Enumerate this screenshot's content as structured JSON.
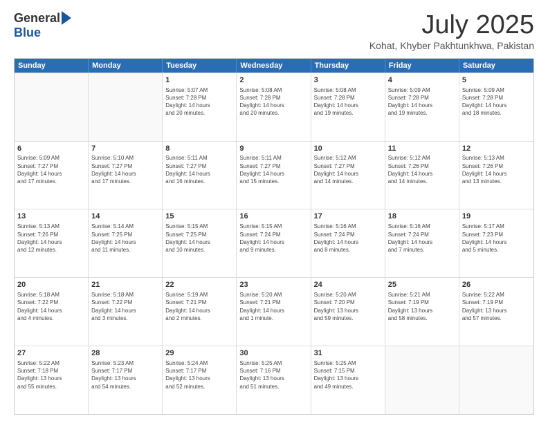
{
  "header": {
    "logo_general": "General",
    "logo_blue": "Blue",
    "month_title": "July 2025",
    "location": "Kohat, Khyber Pakhtunkhwa, Pakistan"
  },
  "weekdays": [
    "Sunday",
    "Monday",
    "Tuesday",
    "Wednesday",
    "Thursday",
    "Friday",
    "Saturday"
  ],
  "weeks": [
    [
      {
        "day": "",
        "info": ""
      },
      {
        "day": "",
        "info": ""
      },
      {
        "day": "1",
        "info": "Sunrise: 5:07 AM\nSunset: 7:28 PM\nDaylight: 14 hours\nand 20 minutes."
      },
      {
        "day": "2",
        "info": "Sunrise: 5:08 AM\nSunset: 7:28 PM\nDaylight: 14 hours\nand 20 minutes."
      },
      {
        "day": "3",
        "info": "Sunrise: 5:08 AM\nSunset: 7:28 PM\nDaylight: 14 hours\nand 19 minutes."
      },
      {
        "day": "4",
        "info": "Sunrise: 5:09 AM\nSunset: 7:28 PM\nDaylight: 14 hours\nand 19 minutes."
      },
      {
        "day": "5",
        "info": "Sunrise: 5:09 AM\nSunset: 7:28 PM\nDaylight: 14 hours\nand 18 minutes."
      }
    ],
    [
      {
        "day": "6",
        "info": "Sunrise: 5:09 AM\nSunset: 7:27 PM\nDaylight: 14 hours\nand 17 minutes."
      },
      {
        "day": "7",
        "info": "Sunrise: 5:10 AM\nSunset: 7:27 PM\nDaylight: 14 hours\nand 17 minutes."
      },
      {
        "day": "8",
        "info": "Sunrise: 5:11 AM\nSunset: 7:27 PM\nDaylight: 14 hours\nand 16 minutes."
      },
      {
        "day": "9",
        "info": "Sunrise: 5:11 AM\nSunset: 7:27 PM\nDaylight: 14 hours\nand 15 minutes."
      },
      {
        "day": "10",
        "info": "Sunrise: 5:12 AM\nSunset: 7:27 PM\nDaylight: 14 hours\nand 14 minutes."
      },
      {
        "day": "11",
        "info": "Sunrise: 5:12 AM\nSunset: 7:26 PM\nDaylight: 14 hours\nand 14 minutes."
      },
      {
        "day": "12",
        "info": "Sunrise: 5:13 AM\nSunset: 7:26 PM\nDaylight: 14 hours\nand 13 minutes."
      }
    ],
    [
      {
        "day": "13",
        "info": "Sunrise: 5:13 AM\nSunset: 7:26 PM\nDaylight: 14 hours\nand 12 minutes."
      },
      {
        "day": "14",
        "info": "Sunrise: 5:14 AM\nSunset: 7:25 PM\nDaylight: 14 hours\nand 11 minutes."
      },
      {
        "day": "15",
        "info": "Sunrise: 5:15 AM\nSunset: 7:25 PM\nDaylight: 14 hours\nand 10 minutes."
      },
      {
        "day": "16",
        "info": "Sunrise: 5:15 AM\nSunset: 7:24 PM\nDaylight: 14 hours\nand 9 minutes."
      },
      {
        "day": "17",
        "info": "Sunrise: 5:16 AM\nSunset: 7:24 PM\nDaylight: 14 hours\nand 8 minutes."
      },
      {
        "day": "18",
        "info": "Sunrise: 5:16 AM\nSunset: 7:24 PM\nDaylight: 14 hours\nand 7 minutes."
      },
      {
        "day": "19",
        "info": "Sunrise: 5:17 AM\nSunset: 7:23 PM\nDaylight: 14 hours\nand 5 minutes."
      }
    ],
    [
      {
        "day": "20",
        "info": "Sunrise: 5:18 AM\nSunset: 7:22 PM\nDaylight: 14 hours\nand 4 minutes."
      },
      {
        "day": "21",
        "info": "Sunrise: 5:18 AM\nSunset: 7:22 PM\nDaylight: 14 hours\nand 3 minutes."
      },
      {
        "day": "22",
        "info": "Sunrise: 5:19 AM\nSunset: 7:21 PM\nDaylight: 14 hours\nand 2 minutes."
      },
      {
        "day": "23",
        "info": "Sunrise: 5:20 AM\nSunset: 7:21 PM\nDaylight: 14 hours\nand 1 minute."
      },
      {
        "day": "24",
        "info": "Sunrise: 5:20 AM\nSunset: 7:20 PM\nDaylight: 13 hours\nand 59 minutes."
      },
      {
        "day": "25",
        "info": "Sunrise: 5:21 AM\nSunset: 7:19 PM\nDaylight: 13 hours\nand 58 minutes."
      },
      {
        "day": "26",
        "info": "Sunrise: 5:22 AM\nSunset: 7:19 PM\nDaylight: 13 hours\nand 57 minutes."
      }
    ],
    [
      {
        "day": "27",
        "info": "Sunrise: 5:22 AM\nSunset: 7:18 PM\nDaylight: 13 hours\nand 55 minutes."
      },
      {
        "day": "28",
        "info": "Sunrise: 5:23 AM\nSunset: 7:17 PM\nDaylight: 13 hours\nand 54 minutes."
      },
      {
        "day": "29",
        "info": "Sunrise: 5:24 AM\nSunset: 7:17 PM\nDaylight: 13 hours\nand 52 minutes."
      },
      {
        "day": "30",
        "info": "Sunrise: 5:25 AM\nSunset: 7:16 PM\nDaylight: 13 hours\nand 51 minutes."
      },
      {
        "day": "31",
        "info": "Sunrise: 5:25 AM\nSunset: 7:15 PM\nDaylight: 13 hours\nand 49 minutes."
      },
      {
        "day": "",
        "info": ""
      },
      {
        "day": "",
        "info": ""
      }
    ]
  ]
}
